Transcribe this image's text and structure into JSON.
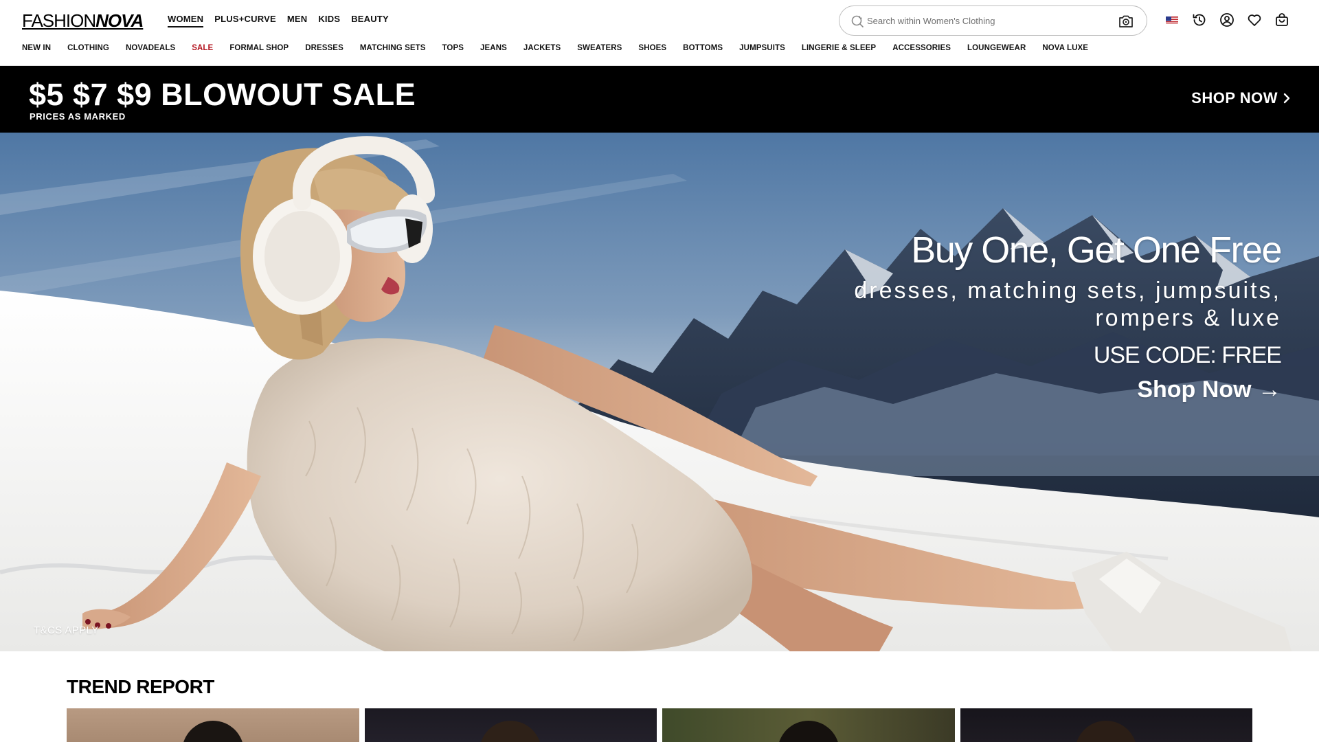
{
  "logo": {
    "part1": "FASHION",
    "part2": "NOVA"
  },
  "top_nav": [
    {
      "label": "WOMEN",
      "active": true
    },
    {
      "label": "PLUS+CURVE",
      "active": false
    },
    {
      "label": "MEN",
      "active": false
    },
    {
      "label": "KIDS",
      "active": false
    },
    {
      "label": "BEAUTY",
      "active": false
    }
  ],
  "search": {
    "placeholder": "Search within Women's Clothing",
    "value": ""
  },
  "header_icons": [
    "us-flag-icon",
    "history-icon",
    "account-icon",
    "wishlist-heart-icon",
    "shopping-bag-icon"
  ],
  "category_nav": [
    "NEW IN",
    "CLOTHING",
    "NOVADEALS",
    "SALE",
    "FORMAL SHOP",
    "DRESSES",
    "MATCHING SETS",
    "TOPS",
    "JEANS",
    "JACKETS",
    "SWEATERS",
    "SHOES",
    "BOTTOMS",
    "JUMPSUITS",
    "LINGERIE & SLEEP",
    "ACCESSORIES",
    "LOUNGEWEAR",
    "NOVA LUXE"
  ],
  "promo": {
    "headline": "$5 $7 $9 BLOWOUT SALE",
    "subtext": "PRICES AS MARKED",
    "cta": "SHOP NOW"
  },
  "hero": {
    "title": "Buy One, Get One Free",
    "line1": "dresses, matching sets, jumpsuits,",
    "line2": "rompers & luxe",
    "code": "USE CODE: FREE",
    "cta": "Shop Now →",
    "disclaimer": "T&CS APPLY"
  },
  "trend": {
    "title": "TREND REPORT"
  },
  "colors": {
    "sale": "#b3141f",
    "promo_bg": "#000000",
    "text": "#111111"
  }
}
